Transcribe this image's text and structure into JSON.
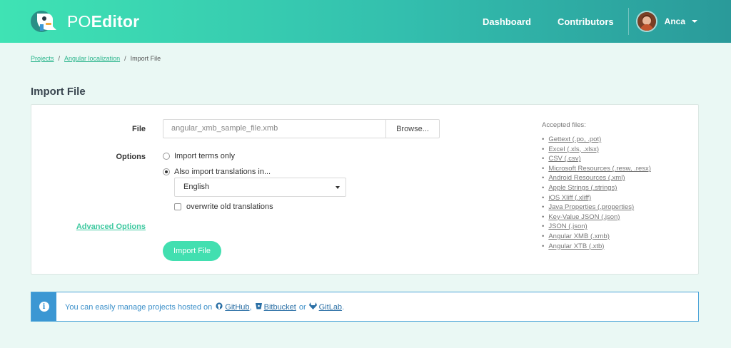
{
  "header": {
    "logo_text_1": "PO",
    "logo_text_2": "Editor",
    "nav": {
      "dashboard": "Dashboard",
      "contributors": "Contributors"
    },
    "user": {
      "name": "Anca"
    }
  },
  "breadcrumb": {
    "items": [
      "Projects",
      "Angular localization",
      "Import File"
    ],
    "separator": "/"
  },
  "page_title": "Import File",
  "form": {
    "file_label": "File",
    "file_value": "angular_xmb_sample_file.xmb",
    "browse_label": "Browse...",
    "options_label": "Options",
    "option_terms_only": "Import terms only",
    "option_also_translations": "Also import translations in...",
    "selected_option": "also_translations",
    "language_value": "English",
    "overwrite_label": "overwrite old translations",
    "overwrite_checked": false,
    "advanced_options": "Advanced Options",
    "import_button": "Import File"
  },
  "accepted": {
    "title": "Accepted files:",
    "items": [
      "Gettext (.po, .pot)",
      "Excel (.xls, .xlsx)",
      "CSV (.csv)",
      "Microsoft Resources (.resw, .resx)",
      "Android Resources (.xml)",
      "Apple Strings (.strings)",
      "iOS Xliff (.xliff)",
      "Java Properties (.properties)",
      "Key-Value JSON (.json)",
      "JSON (.json)",
      "Angular XMB (.xmb)",
      "Angular XTB (.xtb)"
    ]
  },
  "info": {
    "text_before": "You can easily manage projects hosted on",
    "github": "GitHub",
    "comma": ",",
    "bitbucket": "Bitbucket",
    "or": "or",
    "gitlab": "GitLab",
    "period": "."
  },
  "colors": {
    "accent": "#42dfb0",
    "link": "#2bb58c",
    "info_blue": "#3b97d3"
  }
}
